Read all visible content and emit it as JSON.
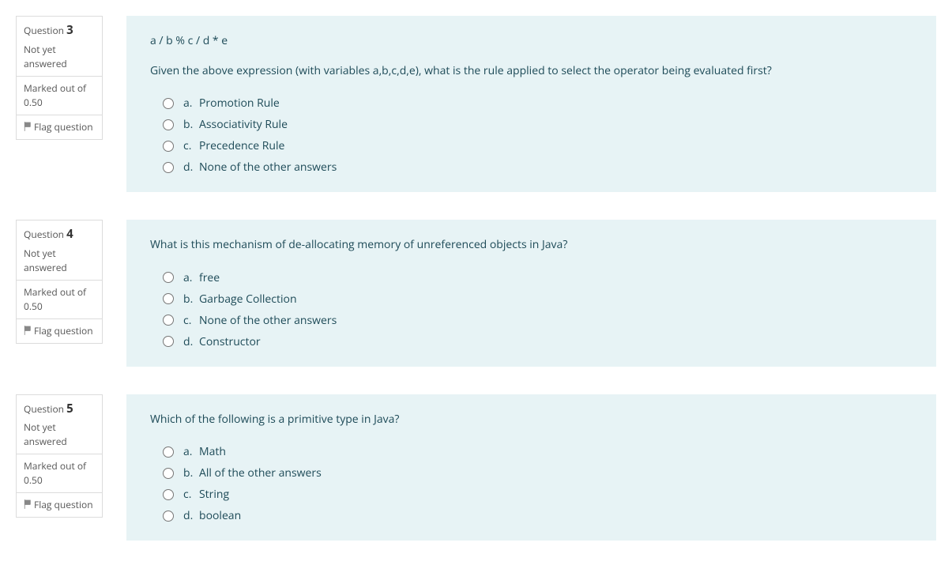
{
  "common": {
    "question_label": "Question",
    "flag_label": "Flag question"
  },
  "questions": [
    {
      "number": "3",
      "status": "Not yet answered",
      "marks": "Marked out of 0.50",
      "preamble": "a / b % c / d * e",
      "prompt": "Given the above expression (with variables a,b,c,d,e), what is the rule applied to select the operator being evaluated first?",
      "options": [
        {
          "letter": "a.",
          "text": "Promotion Rule"
        },
        {
          "letter": "b.",
          "text": "Associativity Rule"
        },
        {
          "letter": "c.",
          "text": "Precedence Rule"
        },
        {
          "letter": "d.",
          "text": "None of the other answers"
        }
      ]
    },
    {
      "number": "4",
      "status": "Not yet answered",
      "marks": "Marked out of 0.50",
      "preamble": "",
      "prompt": "What is this mechanism of de-allocating memory of unreferenced objects in Java?",
      "options": [
        {
          "letter": "a.",
          "text": "free"
        },
        {
          "letter": "b.",
          "text": "Garbage Collection"
        },
        {
          "letter": "c.",
          "text": "None of the other answers"
        },
        {
          "letter": "d.",
          "text": "Constructor"
        }
      ]
    },
    {
      "number": "5",
      "status": "Not yet answered",
      "marks": "Marked out of 0.50",
      "preamble": "",
      "prompt": "Which of the following is a primitive type in Java?",
      "options": [
        {
          "letter": "a.",
          "text": "Math"
        },
        {
          "letter": "b.",
          "text": "All of the other answers"
        },
        {
          "letter": "c.",
          "text": "String"
        },
        {
          "letter": "d.",
          "text": "boolean"
        }
      ]
    }
  ]
}
